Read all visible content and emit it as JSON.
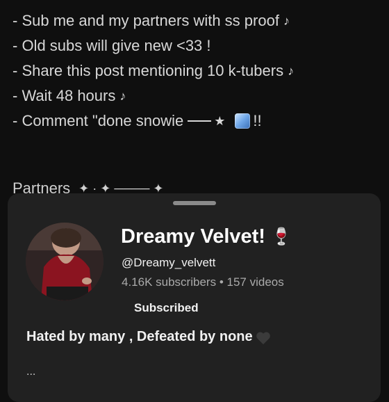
{
  "post": {
    "lines": [
      {
        "text": "- Sub me and my partners with ss proof",
        "suffix": "♪"
      },
      {
        "text": "- Old subs will give new <33 !",
        "suffix": ""
      },
      {
        "text": "- Share this post mentioning 10 k-tubers",
        "suffix": "♪"
      },
      {
        "text": "- Wait 48 hours",
        "suffix": "♪"
      }
    ],
    "comment_prefix": "- Comment  \"done snowie",
    "comment_star": "★",
    "comment_suffix": "!!",
    "partners_label": "Partners",
    "partners_sparkles": "✦ · ✦ ──── ✦"
  },
  "channel": {
    "name": "Dreamy Velvet!",
    "name_emoji": "🍷",
    "handle": "@Dreamy_velvett",
    "subscribers": "4.16K subscribers",
    "separator": "•",
    "videos": "157 videos",
    "subscribe_state": "Subscribed",
    "description": "Hated by many , Defeated by none",
    "more": "..."
  },
  "colors": {
    "background": "#0f0f0f",
    "sheet": "#212121",
    "text_primary": "#ffffff",
    "text_secondary": "#aaaaaa"
  }
}
